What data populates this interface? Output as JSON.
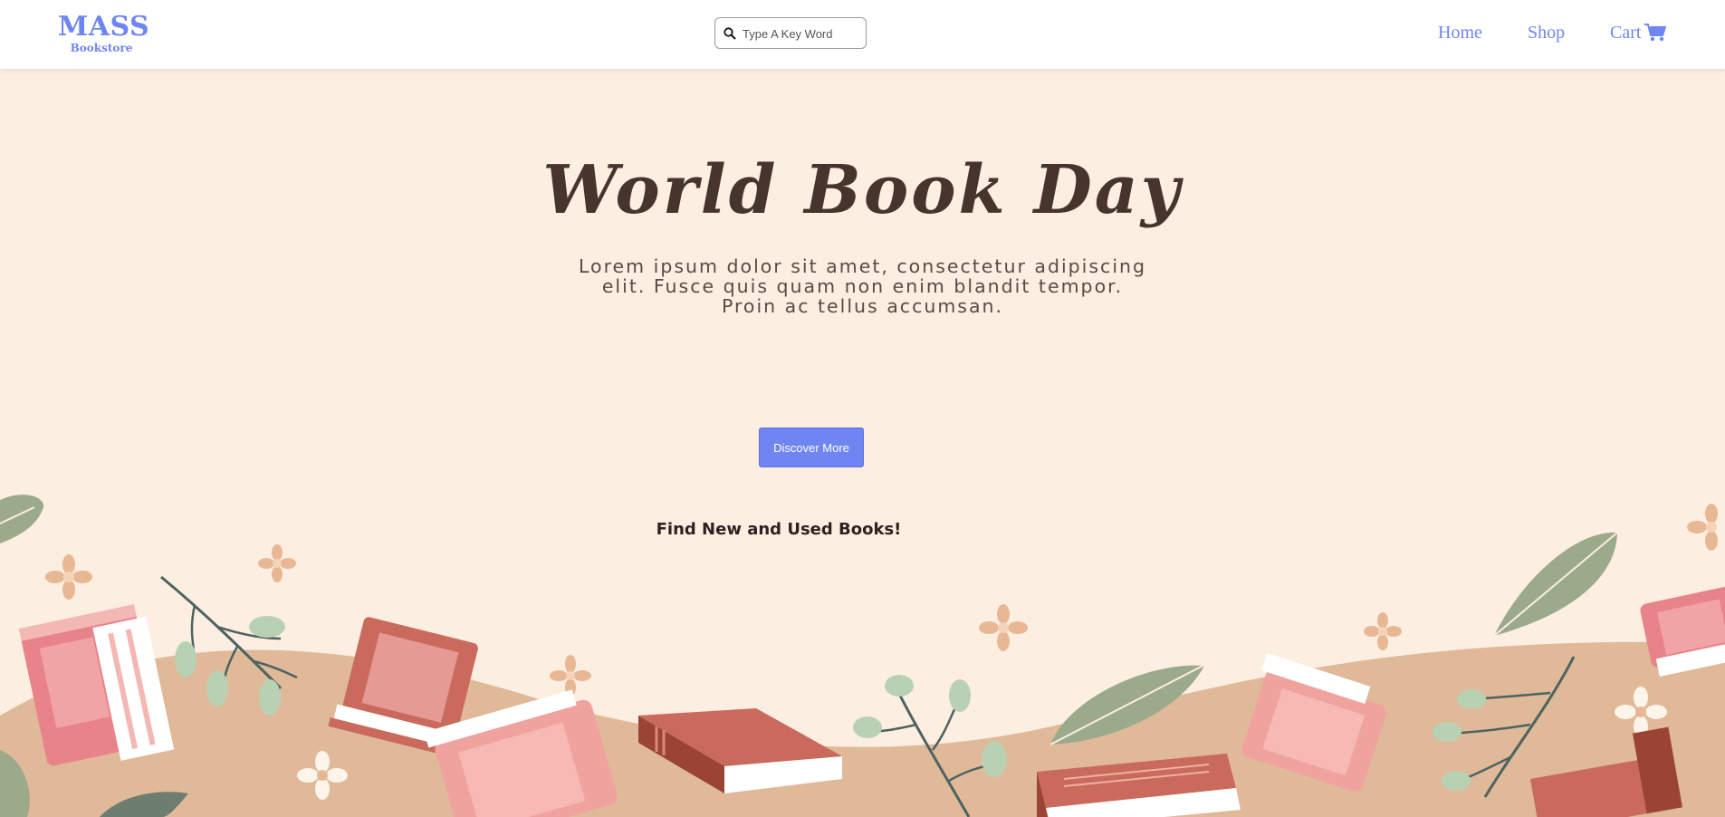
{
  "navbar": {
    "logo_main": "MASS",
    "logo_sub": "Bookstore",
    "search_placeholder": "Type A Key Word",
    "links": [
      "Home",
      "Shop",
      "Cart"
    ],
    "icons": [
      "search-icon",
      "cart-icon"
    ]
  },
  "hero": {
    "title": "World Book Day",
    "text": "Lorem ipsum dolor sit amet, consectetur adipiscing elit. Fusce quis quam non enim blandit tempor. Proin ac tellus accumsan.",
    "button_label": "Discover More",
    "tagline": "Find New and Used Books!"
  },
  "colors": {
    "accent": "#6f86f2",
    "background": "#fdeee2",
    "title": "#47342d",
    "ground": "#e0b999",
    "book_red": "#c96a5c",
    "book_pink": "#f2a49c",
    "leaf": "#9caa8c"
  }
}
